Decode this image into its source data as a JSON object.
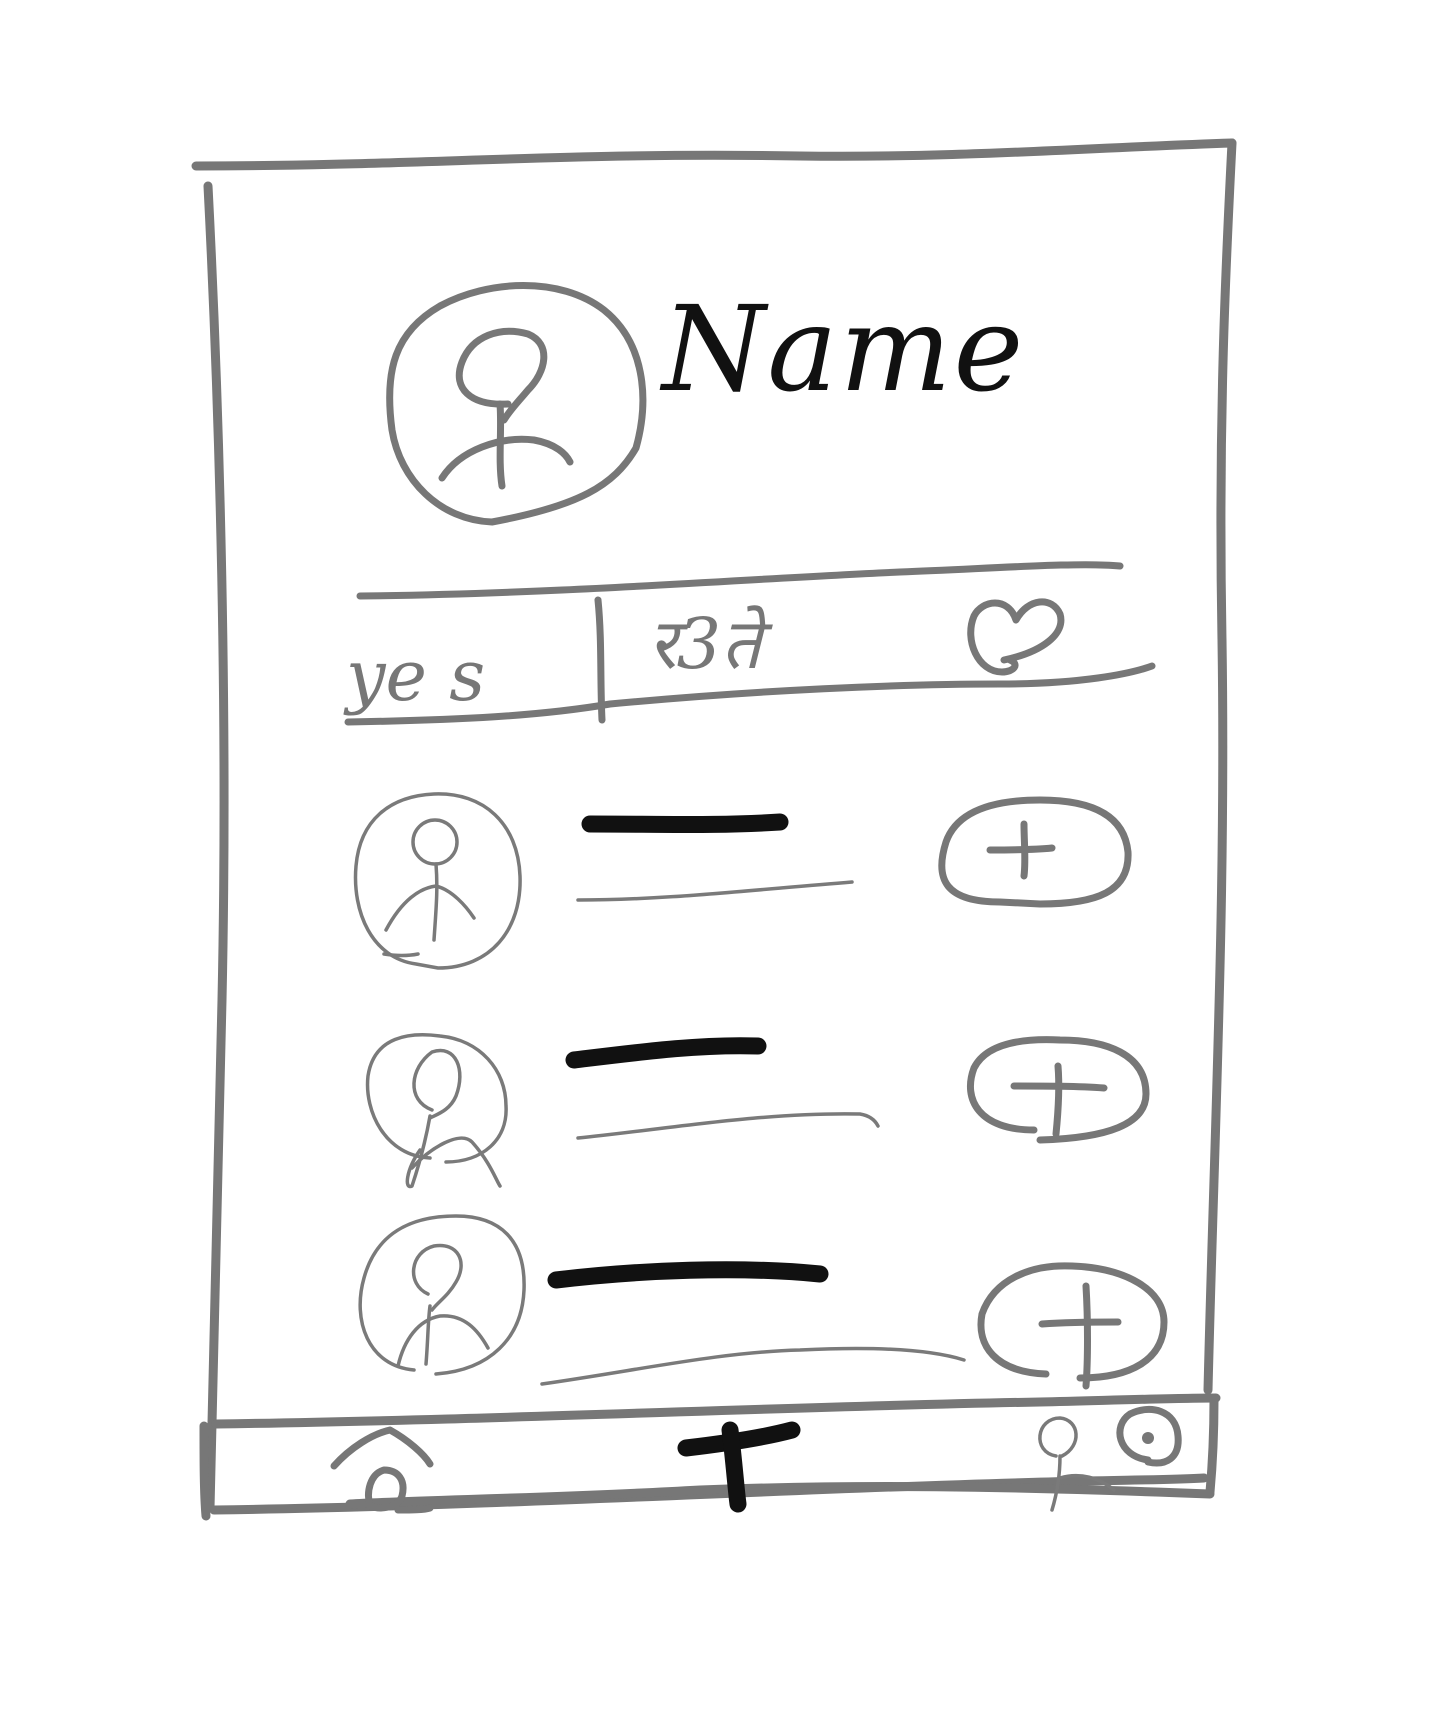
{
  "profile": {
    "name": "Name",
    "avatar_icon": "person-icon"
  },
  "tabs": [
    {
      "label": "ye s",
      "icon": null
    },
    {
      "label": "र3ते",
      "icon": null
    },
    {
      "label": "",
      "icon": "heart-icon"
    }
  ],
  "user_list": {
    "items": [
      {
        "avatar_icon": "person-icon",
        "action_icon": "plus-icon"
      },
      {
        "avatar_icon": "person-icon",
        "action_icon": "plus-icon"
      },
      {
        "avatar_icon": "person-icon",
        "action_icon": "plus-icon"
      }
    ]
  },
  "bottom_nav": {
    "items": [
      {
        "icon": "home-icon"
      },
      {
        "icon": "plus-icon"
      },
      {
        "icon": "profile-settings-icon"
      }
    ]
  },
  "colors": {
    "sketch_stroke": "#777777",
    "ink": "#111111",
    "background": "#ffffff"
  }
}
